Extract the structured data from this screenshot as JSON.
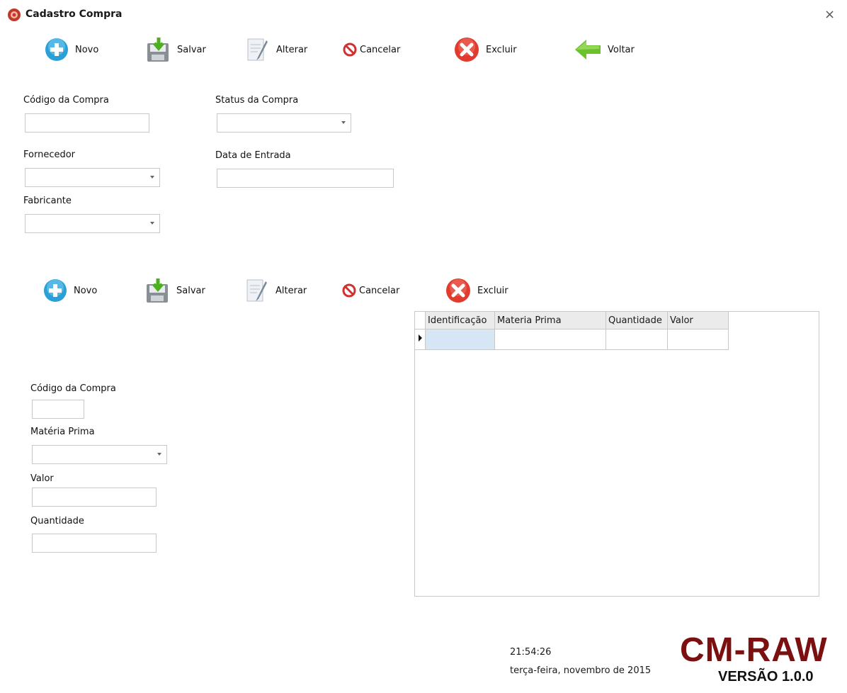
{
  "window": {
    "title": "Cadastro  Compra",
    "close_glyph": "×"
  },
  "toolbar1": {
    "novo": "Novo",
    "salvar": "Salvar",
    "alterar": "Alterar",
    "cancelar": "Cancelar",
    "excluir": "Excluir",
    "voltar": "Voltar"
  },
  "form1": {
    "codigo_label": "Código da Compra",
    "status_label": "Status da Compra",
    "fornecedor_label": "Fornecedor",
    "data_label": "Data de Entrada",
    "fabricante_label": "Fabricante"
  },
  "toolbar2": {
    "novo": "Novo",
    "salvar": "Salvar",
    "alterar": "Alterar",
    "cancelar": "Cancelar",
    "excluir": "Excluir"
  },
  "form2": {
    "codigo_label": "Código da Compra",
    "materia_label": "Matéria Prima",
    "valor_label": "Valor",
    "quantidade_label": "Quantidade"
  },
  "grid": {
    "columns": [
      "Identificação",
      "Materia Prima",
      "Quantidade",
      "Valor"
    ]
  },
  "footer": {
    "time": "21:54:26",
    "date": "terça-feira, novembro de 2015",
    "brand": "CM-RAW",
    "version": "VERSÃO 1.0.0"
  },
  "colors": {
    "brand": "#7a1010",
    "selection": "#d6e6f5"
  }
}
